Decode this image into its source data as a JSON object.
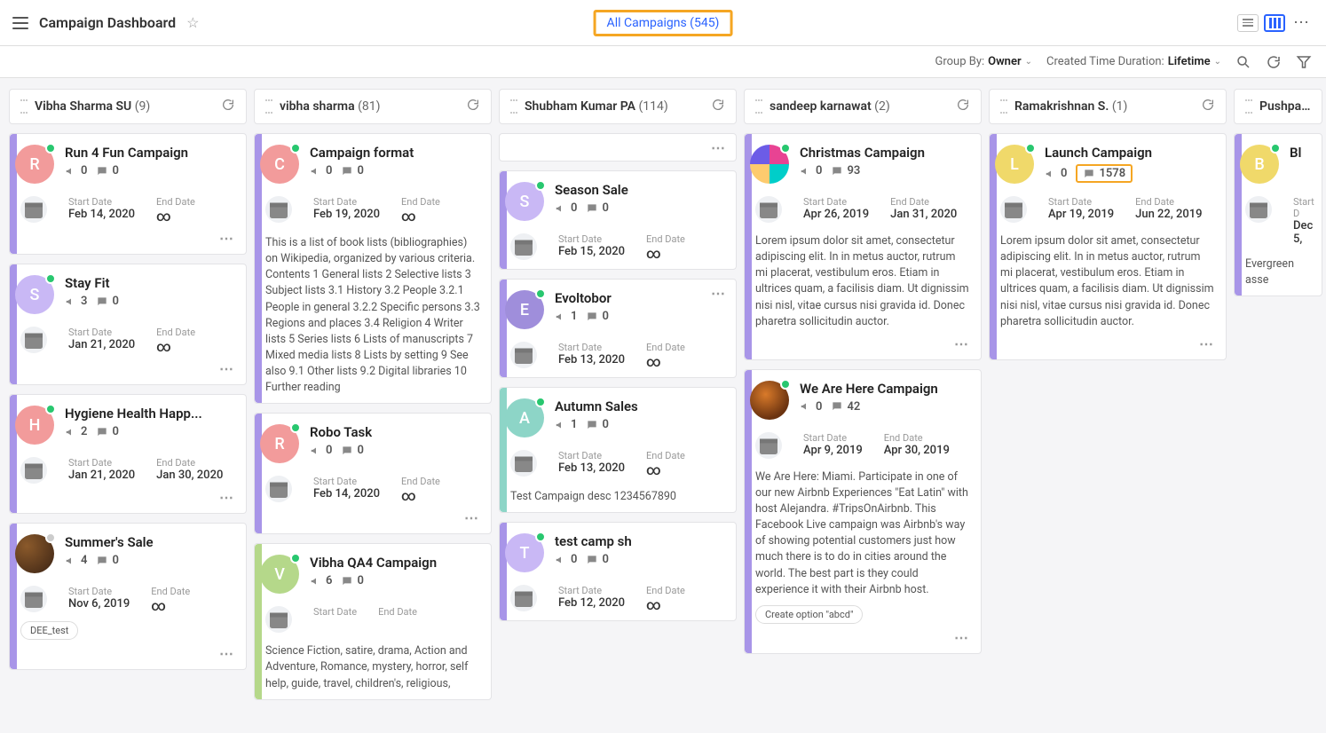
{
  "header": {
    "title": "Campaign Dashboard",
    "all_campaigns_label": "All Campaigns",
    "all_campaigns_count": "(545)"
  },
  "filters": {
    "group_by_label": "Group By:",
    "group_by_value": "Owner",
    "duration_label": "Created Time Duration:",
    "duration_value": "Lifetime"
  },
  "columns": [
    {
      "title": "Vibha Sharma SU",
      "count": "(9)",
      "cards": [
        {
          "accent": "#a895e8",
          "avatar_class": "pink",
          "avatar_letter": "R",
          "status": "green",
          "title": "Run 4 Fun Campaign",
          "m1": "0",
          "m2": "0",
          "start_label": "Start Date",
          "start": "Feb 14, 2020",
          "end_label": "End Date",
          "end": "∞",
          "show_dates": true,
          "show_more": true
        },
        {
          "accent": "#a895e8",
          "avatar_class": "purple",
          "avatar_letter": "S",
          "status": "green",
          "title": "Stay Fit",
          "m1": "3",
          "m2": "0",
          "start_label": "Start Date",
          "start": "Jan 21, 2020",
          "end_label": "End Date",
          "end": "∞",
          "show_dates": true,
          "show_more": true
        },
        {
          "accent": "#a895e8",
          "avatar_class": "pink",
          "avatar_letter": "H",
          "status": "green",
          "title": "Hygiene Health Happ...",
          "m1": "2",
          "m2": "0",
          "start_label": "Start Date",
          "start": "Jan 21, 2020",
          "end_label": "End Date",
          "end": "Jan 30, 2020",
          "show_dates": true,
          "show_more": true
        },
        {
          "accent": "#a895e8",
          "avatar_class": "img-1",
          "avatar_letter": "",
          "status": "gray",
          "title": "Summer's Sale",
          "m1": "4",
          "m2": "0",
          "start_label": "Start Date",
          "start": "Nov 6, 2019",
          "end_label": "End Date",
          "end": "∞",
          "show_dates": true,
          "pill": "DEE_test",
          "show_more": true
        }
      ]
    },
    {
      "title": "vibha sharma",
      "count": "(81)",
      "cards": [
        {
          "accent": "#a895e8",
          "avatar_class": "pink",
          "avatar_letter": "C",
          "status": "green",
          "title": "Campaign format",
          "m1": "0",
          "m2": "0",
          "start_label": "Start Date",
          "start": "Feb 19, 2020",
          "end_label": "End Date",
          "end": "∞",
          "show_dates": true,
          "desc": "This is a list of book lists (bibliographies) on Wikipedia, organized by various criteria. Contents 1 General lists 2 Selective lists 3 Subject lists 3.1 History 3.2 People 3.2.1 People in general 3.2.2 Specific persons 3.3 Regions and places 3.4 Religion 4 Writer lists 5 Series lists 6 Lists of manuscripts 7 Mixed media lists 8 Lists by setting 9 See also 9.1 Other lists 9.2 Digital libraries 10 Further reading"
        },
        {
          "accent": "#a895e8",
          "avatar_class": "pink",
          "avatar_letter": "R",
          "status": "green",
          "title": "Robo Task",
          "m1": "0",
          "m2": "0",
          "start_label": "Start Date",
          "start": "Feb 14, 2020",
          "end_label": "End Date",
          "end": "∞",
          "show_dates": true,
          "show_more": true
        },
        {
          "accent": "#b5d88a",
          "avatar_class": "green",
          "avatar_letter": "V",
          "status": "green",
          "title": "Vibha QA4 Campaign",
          "m1": "6",
          "m2": "0",
          "start_label": "Start Date",
          "start": "",
          "end_label": "End Date",
          "end": "",
          "show_dates": true,
          "desc": "Science Fiction, satire, drama, Action and Adventure, Romance, mystery, horror, self help, guide, travel, children's, religious,"
        }
      ]
    },
    {
      "title": "Shubham Kumar PA",
      "count": "(114)",
      "cards": [
        {
          "more_top": true
        },
        {
          "accent": "#a895e8",
          "avatar_class": "purple",
          "avatar_letter": "S",
          "status": "green",
          "title": "Season Sale",
          "m1": "0",
          "m2": "0",
          "start_label": "Start Date",
          "start": "Feb 15, 2020",
          "end_label": "End Date",
          "end": "∞",
          "show_dates": true
        },
        {
          "accent": "#a895e8",
          "avatar_class": "violet",
          "avatar_letter": "E",
          "status": "green",
          "title": "Evoltobor",
          "m1": "1",
          "m2": "0",
          "start_label": "Start Date",
          "start": "Feb 13, 2020",
          "end_label": "End Date",
          "end": "∞",
          "show_dates": true,
          "more_top": true
        },
        {
          "accent": "#8dd5c7",
          "avatar_class": "teal",
          "avatar_letter": "A",
          "status": "green",
          "title": "Autumn Sales",
          "m1": "1",
          "m2": "0",
          "start_label": "Start Date",
          "start": "Feb 13, 2020",
          "end_label": "End Date",
          "end": "∞",
          "show_dates": true,
          "desc": "Test Campaign desc 1234567890"
        },
        {
          "accent": "#a895e8",
          "avatar_class": "purple",
          "avatar_letter": "T",
          "status": "green",
          "title": "test camp sh",
          "m1": "0",
          "m2": "0",
          "start_label": "Start Date",
          "start": "Feb 12, 2020",
          "end_label": "End Date",
          "end": "∞",
          "show_dates": true
        }
      ]
    },
    {
      "title": "sandeep karnawat",
      "count": "(2)",
      "cards": [
        {
          "accent": "#a895e8",
          "avatar_class": "multi",
          "avatar_letter": "",
          "status": "green",
          "title": "Christmas Campaign",
          "m1": "0",
          "m2": "93",
          "start_label": "Start Date",
          "start": "Apr 26, 2019",
          "end_label": "End Date",
          "end": "Jan 31, 2020",
          "show_dates": true,
          "desc": "Lorem ipsum dolor sit amet, consectetur adipiscing elit. In in metus auctor, rutrum mi placerat, vestibulum eros. Etiam in ultrices quam, a facilisis diam. Ut dignissim nisi nisl, vitae cursus nisi gravida id. Donec pharetra sollicitudin auctor.",
          "show_more": true
        },
        {
          "accent": "#a895e8",
          "avatar_class": "img-2",
          "avatar_letter": "",
          "status": "green",
          "title": "We Are Here Campaign",
          "m1": "0",
          "m2": "42",
          "start_label": "Start Date",
          "start": "Apr 9, 2019",
          "end_label": "End Date",
          "end": "Apr 30, 2019",
          "show_dates": true,
          "desc": "We Are Here: Miami. Participate in one of our new Airbnb Experiences \"Eat Latin\" with host Alejandra. #TripsOnAirbnb. This Facebook Live campaign was Airbnb's way of showing potential customers just how much there is to do in cities around the world. The best part is they could experience it with their Airbnb host.",
          "pill": "Create option \"abcd\"",
          "show_more": true
        }
      ]
    },
    {
      "title": "Ramakrishnan S.",
      "count": "(1)",
      "cards": [
        {
          "accent": "#a895e8",
          "avatar_class": "yellow",
          "avatar_letter": "L",
          "status": "green",
          "title": "Launch Campaign",
          "m1": "0",
          "m2": "1578",
          "m2_boxed": true,
          "start_label": "Start Date",
          "start": "Apr 19, 2019",
          "end_label": "End Date",
          "end": "Jun 22, 2019",
          "show_dates": true,
          "desc": "Lorem ipsum dolor sit amet, consectetur adipiscing elit. In in metus auctor, rutrum mi placerat, vestibulum eros. Etiam in ultrices quam, a facilisis diam. Ut dignissim nisi nisl, vitae cursus nisi gravida id. Donec pharetra sollicitudin auctor.",
          "show_more": true
        }
      ]
    },
    {
      "title": "Pushpam QA",
      "count": "",
      "partial": true,
      "cards": [
        {
          "accent": "#a895e8",
          "avatar_class": "yellow",
          "avatar_letter": "B",
          "status": "green",
          "title": "Bl",
          "m1": "",
          "m2": "",
          "start_label": "Start D",
          "start": "Dec 5,",
          "end_label": "",
          "end": "",
          "show_dates": true,
          "desc": "Evergreen asse"
        }
      ]
    }
  ]
}
